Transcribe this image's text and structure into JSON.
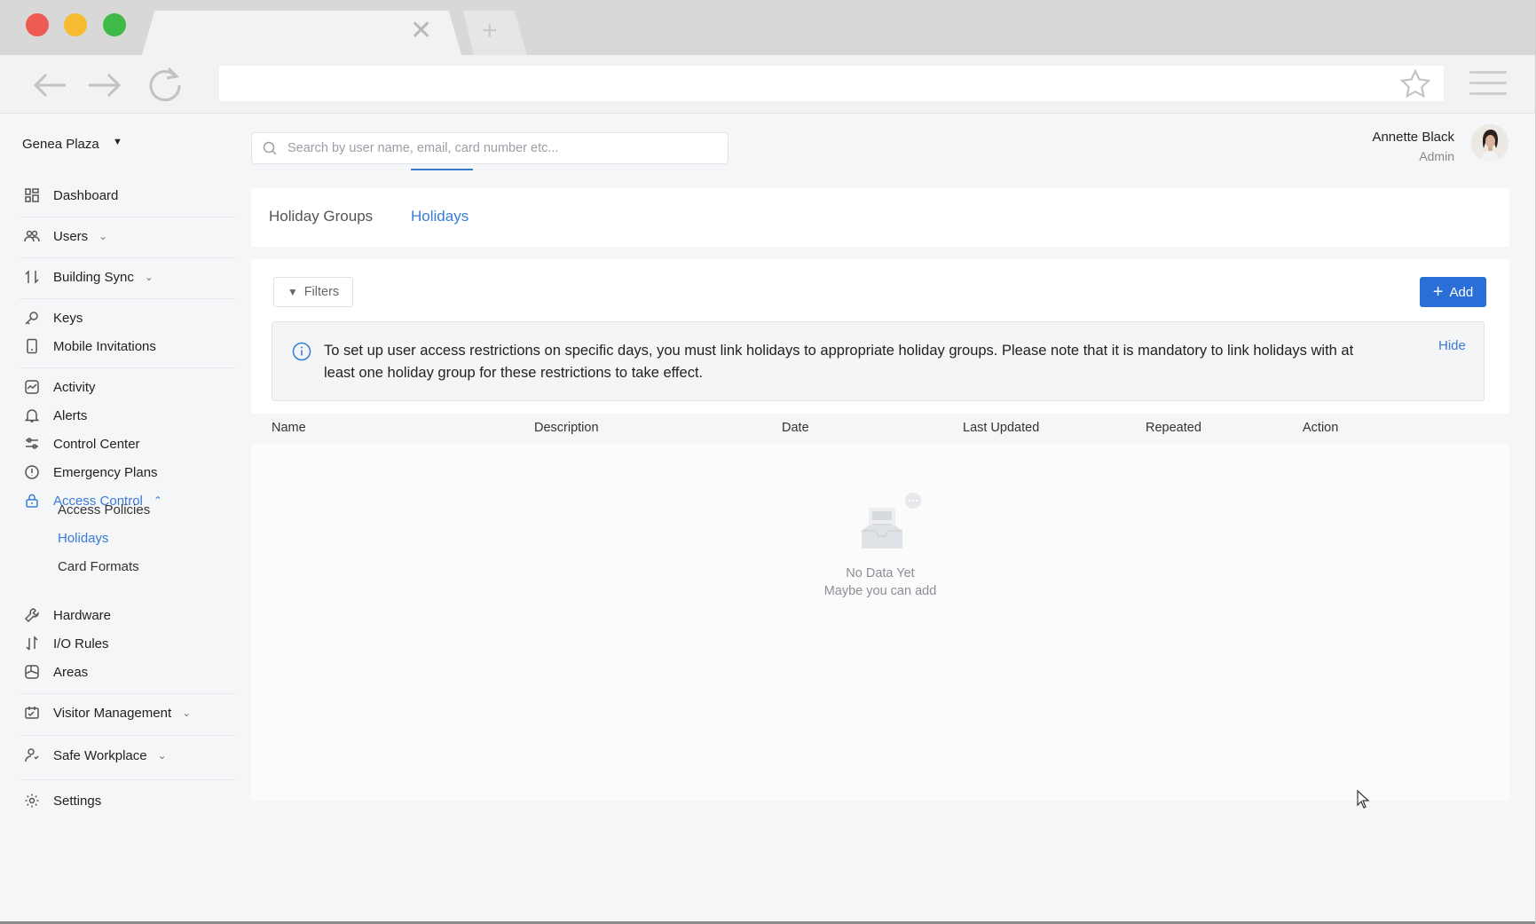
{
  "browser": {
    "tab_close_glyph": "✕",
    "new_tab_glyph": "+",
    "back_icon": "arrow-left-icon",
    "forward_icon": "arrow-right-icon",
    "reload_icon": "reload-icon",
    "bookmark_icon": "star-icon",
    "menu_icon": "hamburger-icon",
    "url": "",
    "traffic_lights": {
      "close": "#ee5b52",
      "minimize": "#f6bb31",
      "maximize": "#3fb948"
    }
  },
  "sidebar": {
    "site_name": "Genea Plaza",
    "items": [
      {
        "label": "Dashboard",
        "icon": "dashboard-icon"
      },
      {
        "label": "Users",
        "icon": "users-icon"
      },
      {
        "label": "Building Sync",
        "icon": "building-sync-icon"
      },
      {
        "label": "Keys",
        "icon": "key-icon"
      },
      {
        "label": "Mobile Invitations",
        "icon": "mobile-icon"
      },
      {
        "label": "Activity",
        "icon": "activity-icon"
      },
      {
        "label": "Alerts",
        "icon": "bell-icon"
      },
      {
        "label": "Control Center",
        "icon": "control-center-icon"
      },
      {
        "label": "Emergency Plans",
        "icon": "emergency-icon"
      },
      {
        "label": "Access Control",
        "icon": "lock-icon"
      },
      {
        "label": "Hardware",
        "icon": "wrench-icon"
      },
      {
        "label": "I/O Rules",
        "icon": "io-rules-icon"
      },
      {
        "label": "Areas",
        "icon": "areas-icon"
      },
      {
        "label": "Visitor Management",
        "icon": "visitor-icon"
      },
      {
        "label": "Safe Workplace",
        "icon": "safe-workplace-icon"
      },
      {
        "label": "Settings",
        "icon": "gear-icon"
      }
    ],
    "access_control_sub": [
      {
        "label": "Access Policies"
      },
      {
        "label": "Holidays"
      },
      {
        "label": "Card Formats"
      }
    ]
  },
  "header": {
    "search_placeholder": "Search by user name, email, card number etc...",
    "user_name": "Annette Black",
    "user_role": "Admin"
  },
  "tabs": [
    {
      "label": "Holiday Groups"
    },
    {
      "label": "Holidays"
    }
  ],
  "toolbar": {
    "filters_label": "Filters",
    "add_label": "Add"
  },
  "info": {
    "text": "To set up user access restrictions on specific days, you must link holidays to appropriate holiday groups. Please note that it is mandatory to link holidays with at least one holiday group for these restrictions to take effect.",
    "hide_label": "Hide"
  },
  "table": {
    "columns": [
      "Name",
      "Description",
      "Date",
      "Last Updated",
      "Repeated",
      "Action"
    ],
    "rows": []
  },
  "empty_state": {
    "title": "No Data Yet",
    "subtitle": "Maybe you can add"
  },
  "colors": {
    "accent": "#3a7bd5",
    "primary_button": "#2a6fd8"
  }
}
